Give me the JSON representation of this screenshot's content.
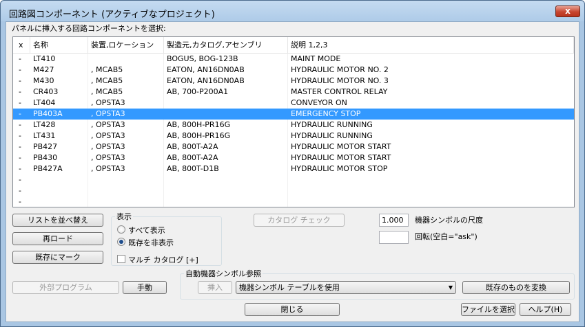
{
  "window": {
    "title": "回路図コンポーネント (アクティブなプロジェクト)",
    "close_label": "x"
  },
  "instruction": "パネルに挿入する回路コンポーネントを選択:",
  "list": {
    "headers": [
      "x",
      "名称",
      "装置,ロケーション",
      "製造元,カタログ,アセンブリ",
      "説明 1,2,3"
    ],
    "rows": [
      [
        "-",
        "LT410",
        "",
        "BOGUS, BOG-123B",
        "MAINT MODE"
      ],
      [
        "-",
        "M427",
        ", MCAB5",
        "EATON, AN16DN0AB",
        "HYDRAULIC MOTOR NO. 2"
      ],
      [
        "-",
        "M430",
        ", MCAB5",
        "EATON, AN16DN0AB",
        "HYDRAULIC MOTOR NO. 3"
      ],
      [
        "-",
        "CR403",
        ", MCAB5",
        "AB, 700-P200A1",
        "MASTER CONTROL RELAY"
      ],
      [
        "-",
        "LT404",
        ", OPSTA3",
        "",
        "CONVEYOR ON"
      ],
      [
        "-",
        "PB403A",
        ", OPSTA3",
        "",
        "EMERGENCY STOP"
      ],
      [
        "-",
        "LT428",
        ", OPSTA3",
        "AB, 800H-PR16G",
        "HYDRAULIC RUNNING"
      ],
      [
        "-",
        "LT431",
        ", OPSTA3",
        "AB, 800H-PR16G",
        "HYDRAULIC RUNNING"
      ],
      [
        "-",
        "PB427",
        ", OPSTA3",
        "AB, 800T-A2A",
        "HYDRAULIC MOTOR START"
      ],
      [
        "-",
        "PB430",
        ", OPSTA3",
        "AB, 800T-A2A",
        "HYDRAULIC MOTOR START"
      ],
      [
        "-",
        "PB427A",
        ", OPSTA3",
        "AB, 800T-D1B",
        "HYDRAULIC MOTOR STOP"
      ],
      [
        "-",
        "",
        "",
        "",
        ""
      ],
      [
        "-",
        "",
        "",
        "",
        ""
      ],
      [
        "-",
        "",
        "",
        "",
        ""
      ]
    ],
    "selected_row": 5
  },
  "buttons": {
    "sort_list": "リストを並べ替え",
    "reload": "再ロード",
    "mark_existing": "既存にマーク",
    "catalog_check": "カタログ チェック",
    "external_program": "外部プログラム",
    "manual": "手動",
    "insert": "挿入",
    "convert_existing": "既存のものを変換",
    "close": "閉じる",
    "select_file": "ファイルを選択",
    "help": "ヘルプ(H)"
  },
  "display_group": {
    "title": "表示",
    "show_all": "すべて表示",
    "hide_existing": "既存を非表示",
    "multi_catalog": "マルチ カタログ [+]",
    "selected": "hide_existing"
  },
  "scale": {
    "value": "1.000",
    "label": "機器シンボルの尺度"
  },
  "rotation": {
    "value": "",
    "label": "回転(空白=\"ask\")"
  },
  "auto_symbol_group": {
    "title": "自動機器シンボル参照",
    "combo_value": "機器シンボル テーブルを使用"
  },
  "colors": {
    "selection": "#3399ff",
    "title_bar": "#aecbe8"
  }
}
